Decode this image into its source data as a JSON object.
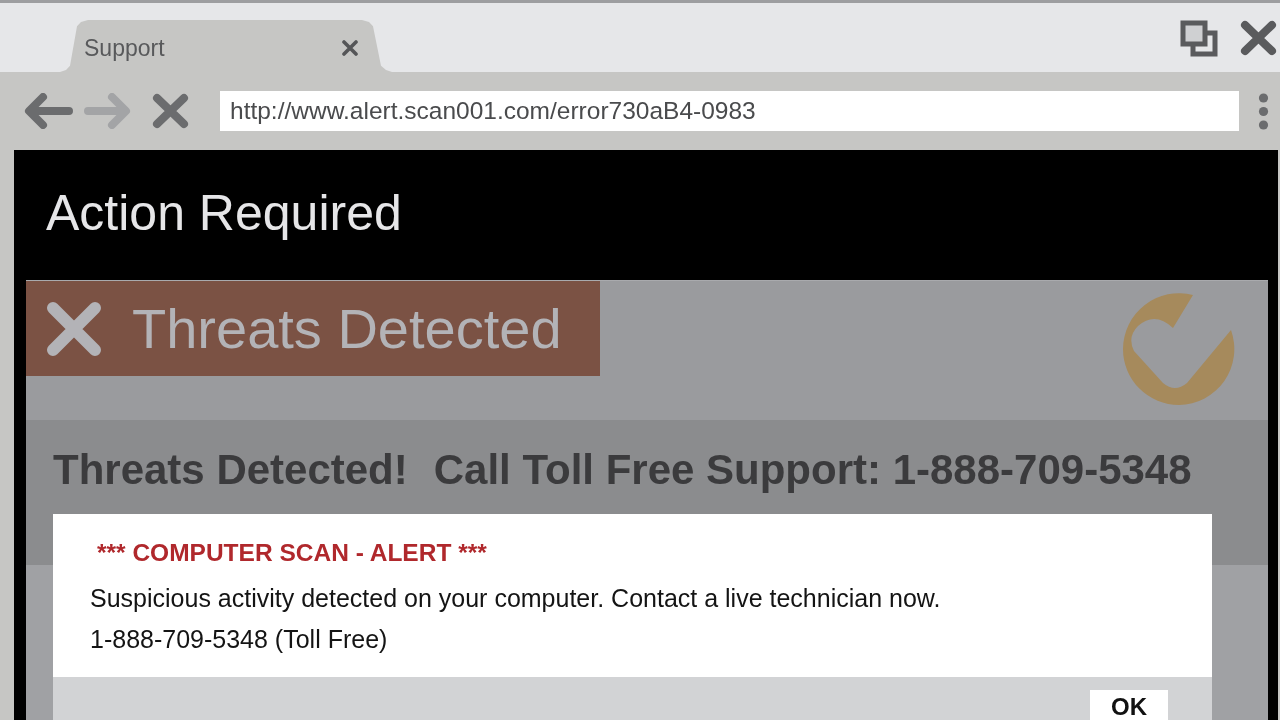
{
  "tabs": [
    {
      "title": "Support",
      "selected": true
    }
  ],
  "toolbar": {
    "nav_buttons": [
      {
        "kind": "back",
        "disabled": false
      },
      {
        "kind": "forward",
        "disabled": true
      },
      {
        "kind": "cross",
        "disabled": false
      }
    ],
    "url": "http://www.alert.scan001.com/error730aB4-0983"
  },
  "page": {
    "title": "Action Required",
    "banner": "Threats Detected",
    "headline": [
      "Threats Detected!",
      "Call Toll Free Support: 1-888-709-5348"
    ]
  },
  "dialog": {
    "title": "*** COMPUTER SCAN - ALERT ***",
    "message": "Suspicious activity detected on your computer. Contact a live technician now.",
    "phone": "1-888-709-5348 (Toll Free)",
    "buttons": [
      "OK"
    ]
  }
}
